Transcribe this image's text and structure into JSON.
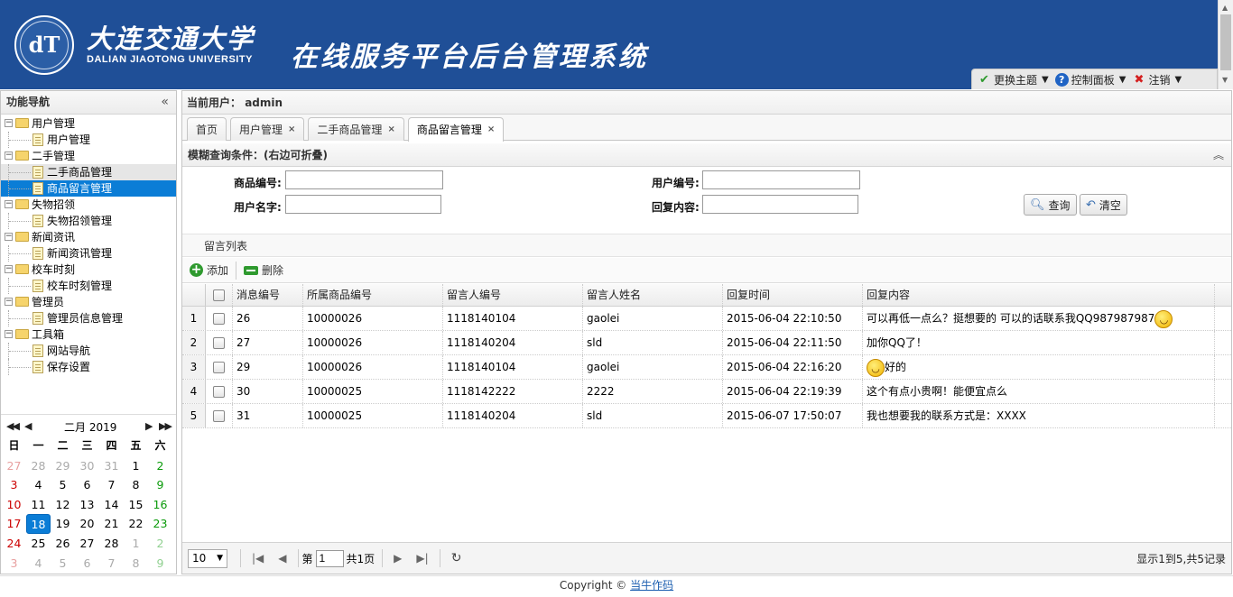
{
  "header": {
    "logo_mark": "dT",
    "university_cn": "大连交通大学",
    "university_en": "DALIAN JIAOTONG UNIVERSITY",
    "system_title": "在线服务平台后台管理系统",
    "color": "#1f4f97"
  },
  "topbar": {
    "theme": "更换主题",
    "control_panel": "控制面板",
    "logout": "注销"
  },
  "west": {
    "title": "功能导航",
    "tree": [
      {
        "label": "用户管理",
        "children": [
          "用户管理"
        ]
      },
      {
        "label": "二手管理",
        "children": [
          "二手商品管理",
          "商品留言管理"
        ]
      },
      {
        "label": "失物招领",
        "children": [
          "失物招领管理"
        ]
      },
      {
        "label": "新闻资讯",
        "children": [
          "新闻资讯管理"
        ]
      },
      {
        "label": "校车时刻",
        "children": [
          "校车时刻管理"
        ]
      },
      {
        "label": "管理员",
        "children": [
          "管理员信息管理"
        ]
      },
      {
        "label": "工具箱",
        "children": [
          "网站导航",
          "保存设置"
        ]
      }
    ],
    "selected": "商品留言管理"
  },
  "calendar": {
    "title": "二月 2019",
    "weekdays": [
      "日",
      "一",
      "二",
      "三",
      "四",
      "五",
      "六"
    ],
    "weeks": [
      [
        "27",
        "28",
        "29",
        "30",
        "31",
        "1",
        "2"
      ],
      [
        "3",
        "4",
        "5",
        "6",
        "7",
        "8",
        "9"
      ],
      [
        "10",
        "11",
        "12",
        "13",
        "14",
        "15",
        "16"
      ],
      [
        "17",
        "18",
        "19",
        "20",
        "21",
        "22",
        "23"
      ],
      [
        "24",
        "25",
        "26",
        "27",
        "28",
        "1",
        "2"
      ],
      [
        "3",
        "4",
        "5",
        "6",
        "7",
        "8",
        "9"
      ]
    ],
    "today": "18"
  },
  "center": {
    "current_user_label": "当前用户：",
    "current_user": "admin",
    "tabs": [
      {
        "label": "首页",
        "closable": false
      },
      {
        "label": "用户管理",
        "closable": true
      },
      {
        "label": "二手商品管理",
        "closable": true
      },
      {
        "label": "商品留言管理",
        "closable": true
      }
    ],
    "tab_close": "×",
    "query": {
      "title": "模糊查询条件：(右边可折叠)",
      "goods_no_label": "商品编号:",
      "user_no_label": "用户编号:",
      "user_name_label": "用户名字:",
      "reply_label": "回复内容:",
      "goods_no_value": "",
      "user_no_value": "",
      "user_name_value": "",
      "reply_value": "",
      "search_btn": "查询",
      "clear_btn": "清空"
    },
    "list_title": "留言列表",
    "toolbar": {
      "add": "添加",
      "delete": "删除"
    },
    "grid": {
      "columns": [
        "消息编号",
        "所属商品编号",
        "留言人编号",
        "留言人姓名",
        "回复时间",
        "回复内容"
      ],
      "rows": [
        {
          "rn": "1",
          "cells": [
            "26",
            "10000026",
            "1118140104",
            "gaolei",
            "2015-06-04 22:10:50",
            "可以再低一点么？挺想要的 可以的话联系我QQ987987987"
          ],
          "smiley": "after"
        },
        {
          "rn": "2",
          "cells": [
            "27",
            "10000026",
            "1118140204",
            "sld",
            "2015-06-04 22:11:50",
            "加你QQ了！"
          ],
          "smiley": "none"
        },
        {
          "rn": "3",
          "cells": [
            "29",
            "10000026",
            "1118140104",
            "gaolei",
            "2015-06-04 22:16:20",
            "好的"
          ],
          "smiley": "before"
        },
        {
          "rn": "4",
          "cells": [
            "30",
            "10000025",
            "1118142222",
            "2222",
            "2015-06-04 22:19:39",
            "这个有点小贵啊！能便宜点么"
          ],
          "smiley": "none"
        },
        {
          "rn": "5",
          "cells": [
            "31",
            "10000025",
            "1118140204",
            "sld",
            "2015-06-07 17:50:07",
            "我也想要我的联系方式是：XXXX"
          ],
          "smiley": "none"
        }
      ]
    },
    "pager": {
      "page_size": "10",
      "page_prefix": "第",
      "page_value": "1",
      "page_suffix": "共1页",
      "info": "显示1到5,共5记录"
    }
  },
  "footer": {
    "copyright": "Copyright ©",
    "author": "当牛作码"
  }
}
